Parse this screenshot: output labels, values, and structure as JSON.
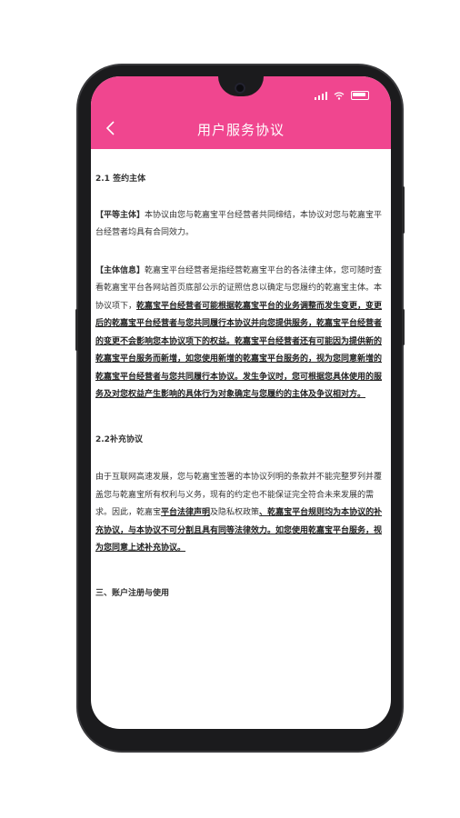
{
  "header": {
    "title": "用户服务协议",
    "back_icon": "chevron-left-icon",
    "color": "#f0468f"
  },
  "status_bar": {
    "icons": [
      "signal-icon",
      "wifi-icon",
      "battery-icon"
    ]
  },
  "sections": {
    "s1_heading": "2.1 签约主体",
    "p1_label": "【平等主体】",
    "p1_text": "本协议由您与乾嘉宝平台经营者共同缔结，本协议对您与乾嘉宝平台经营者均具有合同效力。",
    "p2_label": "【主体信息】",
    "p2_text": "乾嘉宝平台经营者是指经营乾嘉宝平台的各法律主体，您可随时查看乾嘉宝平台各网站首页底部公示的证照信息以确定与您履约的乾嘉宝主体。本协议项下，",
    "p2_underline": "乾嘉宝平台经营者可能根据乾嘉宝平台的业务调整而发生变更，变更后的乾嘉宝平台经营者与您共同履行本协议并向您提供服务，乾嘉宝平台经营者的变更不会影响您本协议项下的权益。乾嘉宝平台经营者还有可能因为提供新的乾嘉宝平台服务而新增，如您使用新增的乾嘉宝平台服务的，视为您同意新增的乾嘉宝平台经营者与您共同履行本协议。发生争议时，您可根据您具体使用的服务及对您权益产生影响的具体行为对象确定与您履约的主体及争议相对方。",
    "s2_heading": "2.2补充协议",
    "p3_text": "由于互联网高速发展，您与乾嘉宝签署的本协议列明的条款并不能完整罗列并覆盖您与乾嘉宝所有权利与义务，现有的约定也不能保证完全符合未来发展的需求。因此，乾嘉宝",
    "p3_link1": "平台法律声明",
    "p3_and": "及",
    "p3_text2": "隐私权政策",
    "p3_underline": "、乾嘉宝平台规则均为本协议的补充协议，与本协议不可分割且具有同等法律效力。如您使用乾嘉宝平台服务，视为您同意上述补充协议。",
    "s3_heading": "三、账户注册与使用"
  }
}
